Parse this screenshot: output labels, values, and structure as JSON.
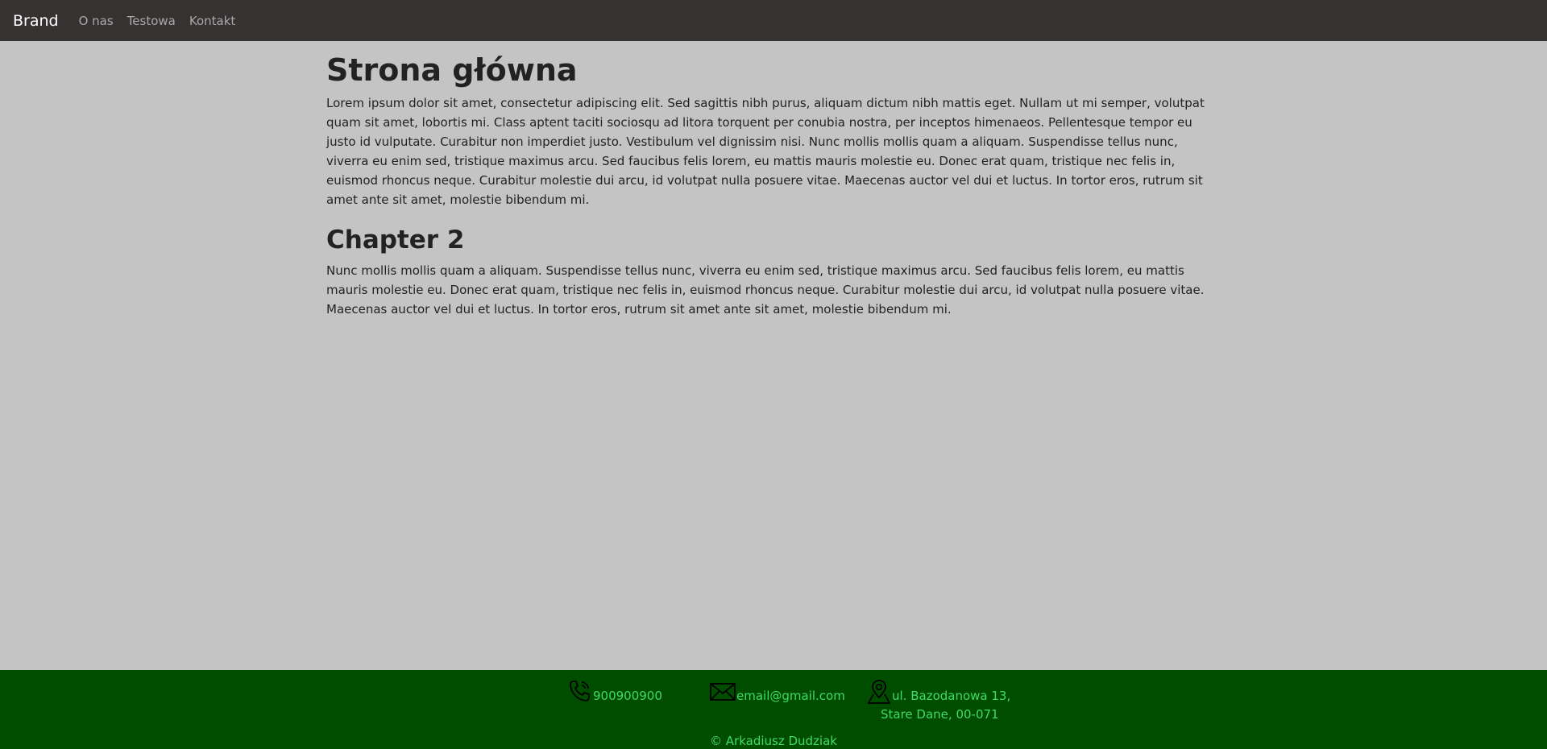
{
  "navbar": {
    "brand": "Brand",
    "links": [
      "O nas",
      "Testowa",
      "Kontakt"
    ]
  },
  "main": {
    "title": "Strona główna",
    "paragraph1": "Lorem ipsum dolor sit amet, consectetur adipiscing elit. Sed sagittis nibh purus, aliquam dictum nibh mattis eget. Nullam ut mi semper, volutpat quam sit amet, lobortis mi. Class aptent taciti sociosqu ad litora torquent per conubia nostra, per inceptos himenaeos. Pellentesque tempor eu justo id vulputate. Curabitur non imperdiet justo. Vestibulum vel dignissim nisi. Nunc mollis mollis quam a aliquam. Suspendisse tellus nunc, viverra eu enim sed, tristique maximus arcu. Sed faucibus felis lorem, eu mattis mauris molestie eu. Donec erat quam, tristique nec felis in, euismod rhoncus neque. Curabitur molestie dui arcu, id volutpat nulla posuere vitae. Maecenas auctor vel dui et luctus. In tortor eros, rutrum sit amet ante sit amet, molestie bibendum mi.",
    "chapter_title": "Chapter 2",
    "paragraph2": "Nunc mollis mollis quam a aliquam. Suspendisse tellus nunc, viverra eu enim sed, tristique maximus arcu. Sed faucibus felis lorem, eu mattis mauris molestie eu. Donec erat quam, tristique nec felis in, euismod rhoncus neque. Curabitur molestie dui arcu, id volutpat nulla posuere vitae. Maecenas auctor vel dui et luctus. In tortor eros, rutrum sit amet ante sit amet, molestie bibendum mi."
  },
  "footer": {
    "phone": "900900900",
    "email": "email@gmail.com",
    "address_line1": "ul. Bazodanowa 13,",
    "address_line2": "Stare Dane, 00-071",
    "copyright": "© Arkadiusz Dudziak",
    "icons": [
      "phone-icon",
      "mail-icon",
      "location-icon"
    ]
  },
  "colors": {
    "navbar_bg": "#363232",
    "page_bg": "#c4c4c4",
    "footer_bg": "#004d00",
    "footer_text": "#3ddc68"
  }
}
